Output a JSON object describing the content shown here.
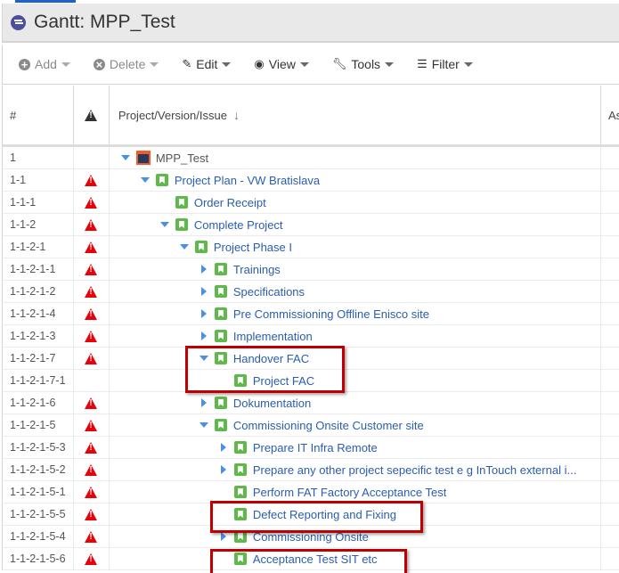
{
  "title": "Gantt:  MPP_Test",
  "toolbar": {
    "add": "Add",
    "delete": "Delete",
    "edit": "Edit",
    "view": "View",
    "tools": "Tools",
    "filter": "Filter"
  },
  "columns": {
    "num": "#",
    "name": "Project/Version/Issue",
    "next": "As"
  },
  "rows": [
    {
      "num": "1",
      "warn": false,
      "level": 0,
      "toggle": "down",
      "icon": "project",
      "label": "MPP_Test"
    },
    {
      "num": "1-1",
      "warn": true,
      "level": 1,
      "toggle": "down",
      "icon": "bookmark",
      "label": "Project Plan - VW Bratislava"
    },
    {
      "num": "1-1-1",
      "warn": true,
      "level": 2,
      "toggle": "none",
      "icon": "bookmark",
      "label": "Order Receipt"
    },
    {
      "num": "1-1-2",
      "warn": true,
      "level": 2,
      "toggle": "down",
      "icon": "bookmark",
      "label": "Complete Project"
    },
    {
      "num": "1-1-2-1",
      "warn": true,
      "level": 3,
      "toggle": "down",
      "icon": "bookmark",
      "label": "Project Phase I"
    },
    {
      "num": "1-1-2-1-1",
      "warn": true,
      "level": 4,
      "toggle": "right",
      "icon": "bookmark",
      "label": "Trainings"
    },
    {
      "num": "1-1-2-1-2",
      "warn": true,
      "level": 4,
      "toggle": "right",
      "icon": "bookmark",
      "label": "Specifications"
    },
    {
      "num": "1-1-2-1-4",
      "warn": true,
      "level": 4,
      "toggle": "right",
      "icon": "bookmark",
      "label": "Pre Commissioning Offline Enisco site"
    },
    {
      "num": "1-1-2-1-3",
      "warn": true,
      "level": 4,
      "toggle": "right",
      "icon": "bookmark",
      "label": "Implementation"
    },
    {
      "num": "1-1-2-1-7",
      "warn": true,
      "level": 4,
      "toggle": "down",
      "icon": "bookmark",
      "label": "Handover FAC"
    },
    {
      "num": "1-1-2-1-7-1",
      "warn": false,
      "level": 5,
      "toggle": "none",
      "icon": "bookmark",
      "label": "Project FAC"
    },
    {
      "num": "1-1-2-1-6",
      "warn": true,
      "level": 4,
      "toggle": "right",
      "icon": "bookmark",
      "label": "Dokumentation"
    },
    {
      "num": "1-1-2-1-5",
      "warn": true,
      "level": 4,
      "toggle": "down",
      "icon": "bookmark",
      "label": "Commissioning Onsite Customer site"
    },
    {
      "num": "1-1-2-1-5-3",
      "warn": true,
      "level": 5,
      "toggle": "right",
      "icon": "bookmark",
      "label": "Prepare IT Infra Remote"
    },
    {
      "num": "1-1-2-1-5-2",
      "warn": true,
      "level": 5,
      "toggle": "right",
      "icon": "bookmark",
      "label": "Prepare any other project sepecific test e g InTouch external i..."
    },
    {
      "num": "1-1-2-1-5-1",
      "warn": true,
      "level": 5,
      "toggle": "none",
      "icon": "bookmark",
      "label": "Perform FAT Factory Acceptance Test"
    },
    {
      "num": "1-1-2-1-5-5",
      "warn": true,
      "level": 5,
      "toggle": "none",
      "icon": "bookmark",
      "label": "Defect Reporting and Fixing"
    },
    {
      "num": "1-1-2-1-5-4",
      "warn": true,
      "level": 5,
      "toggle": "right",
      "icon": "bookmark",
      "label": "Commissioning Onsite"
    },
    {
      "num": "1-1-2-1-5-6",
      "warn": true,
      "level": 5,
      "toggle": "none",
      "icon": "bookmark",
      "label": "Acceptance Test SIT etc"
    }
  ],
  "annotations": [
    "Handover FAC / Project FAC",
    "Defect Reporting and Fixing",
    "Acceptance Test SIT etc"
  ],
  "colors": {
    "link": "#2a5db0",
    "warning": "#e8000a",
    "bookmark": "#5fb84a",
    "annotation": "#c00000"
  }
}
